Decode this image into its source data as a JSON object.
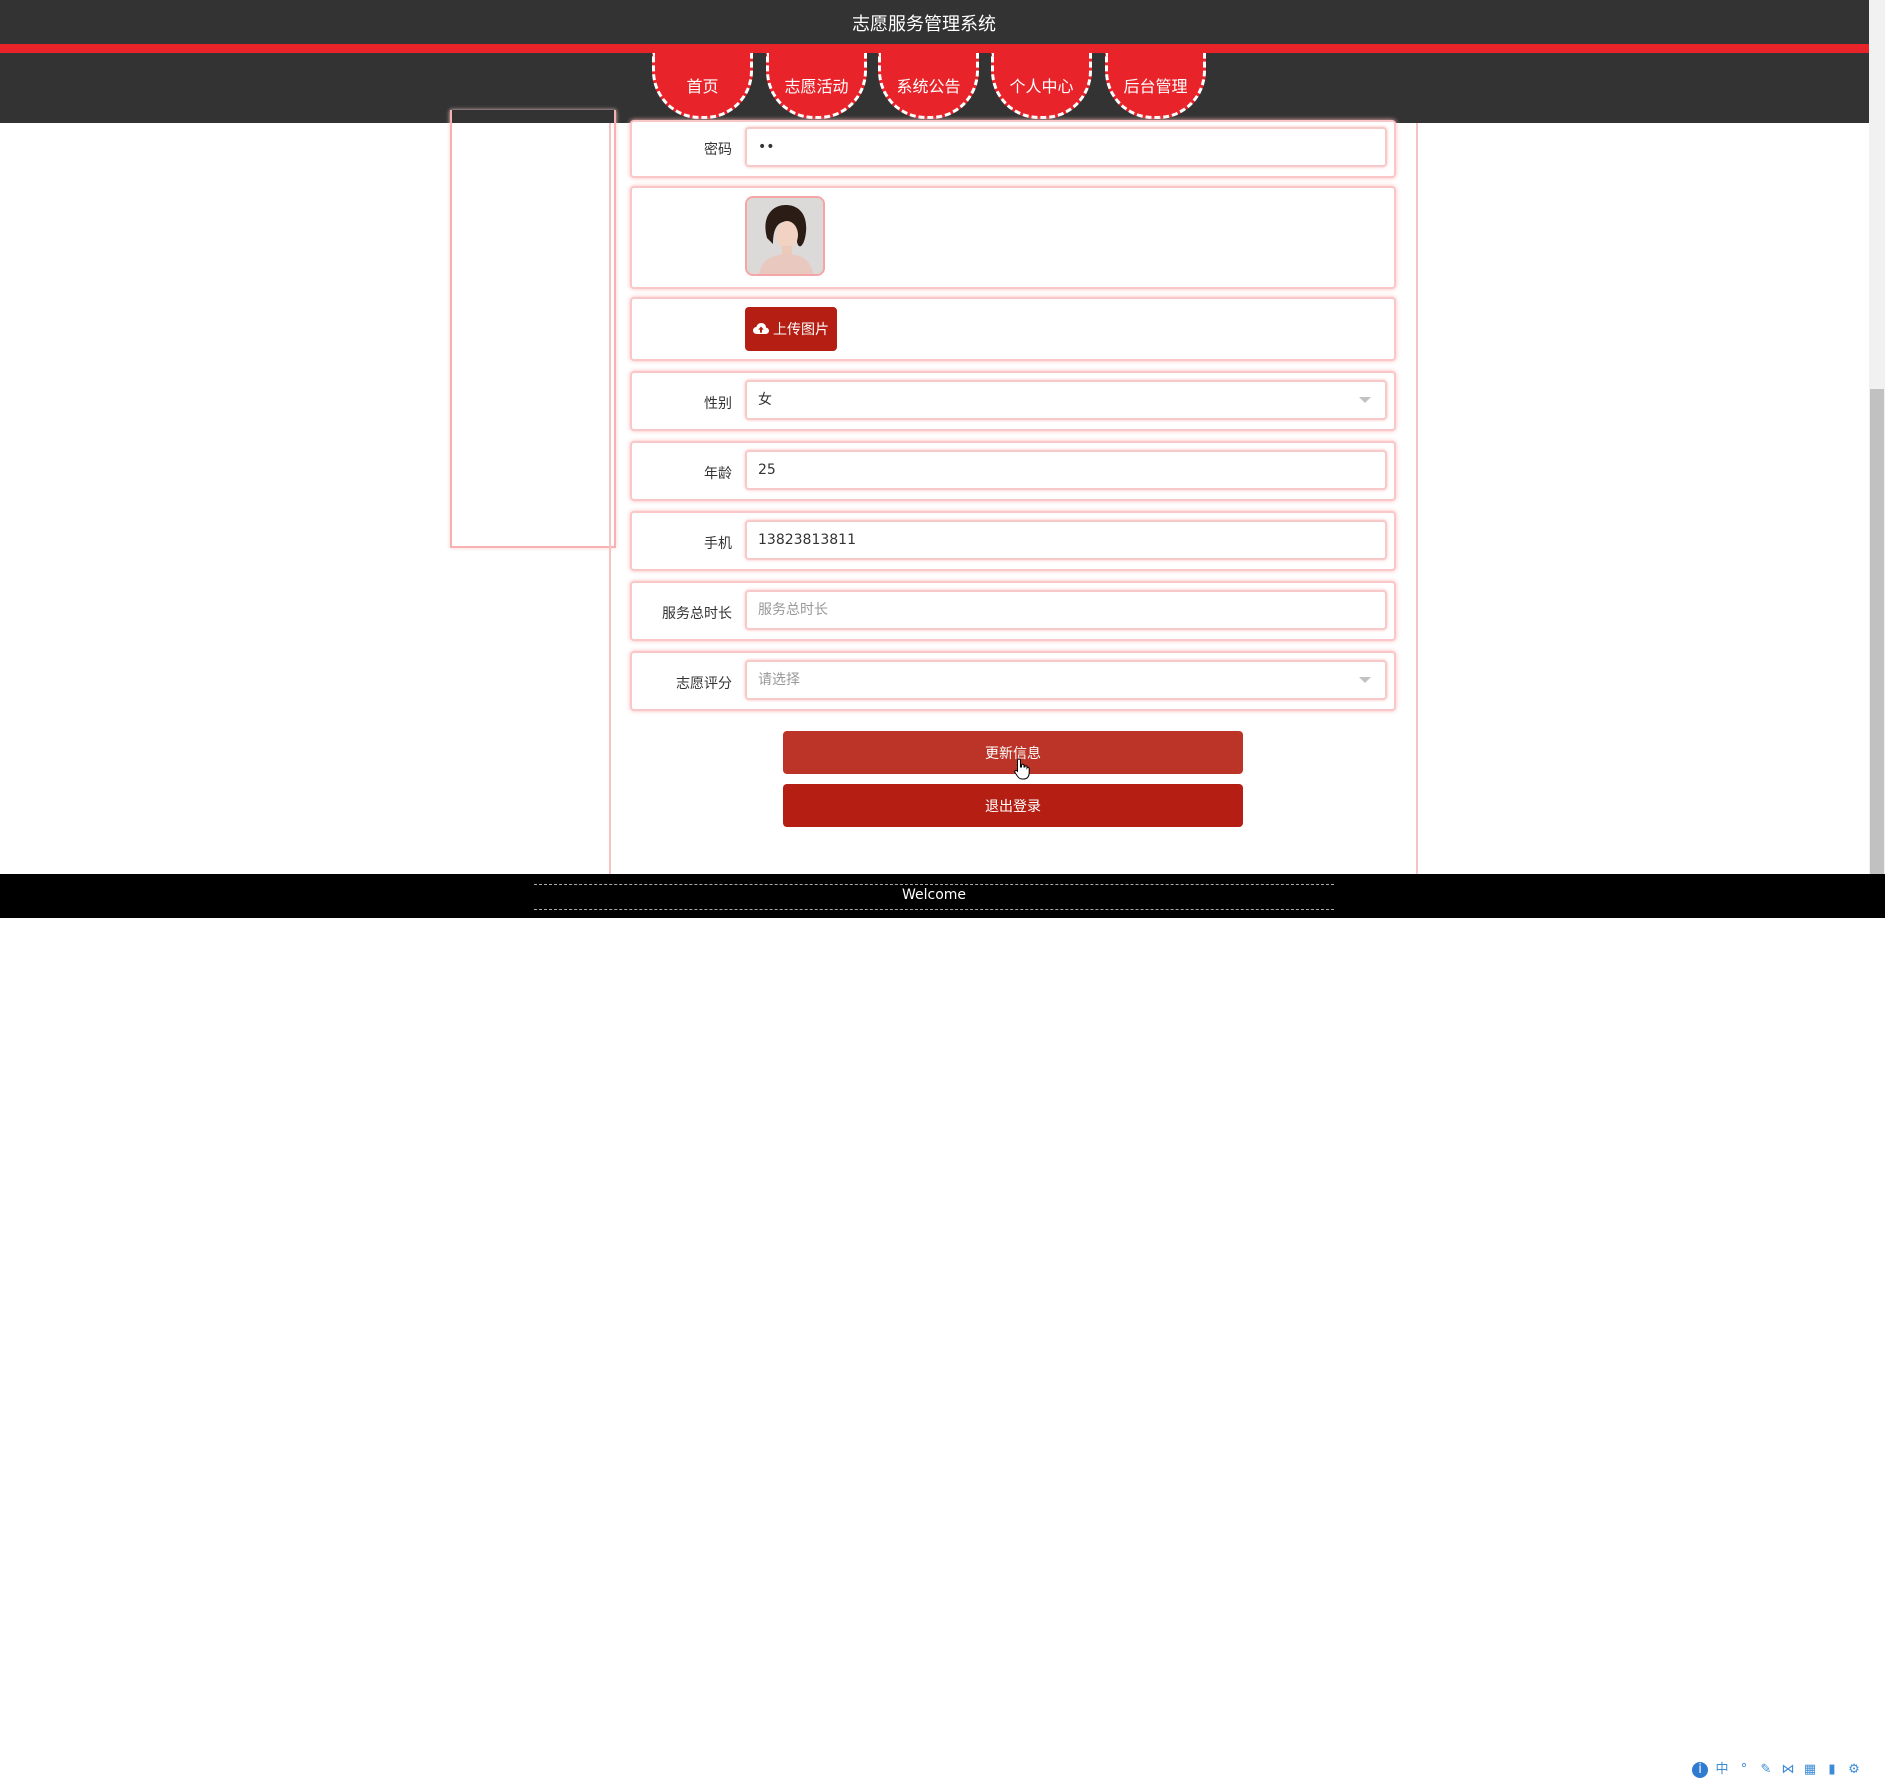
{
  "header": {
    "title": "志愿服务管理系统"
  },
  "nav": {
    "items": [
      "首页",
      "志愿活动",
      "系统公告",
      "个人中心",
      "后台管理"
    ]
  },
  "form": {
    "password": {
      "label": "密码",
      "value": "••"
    },
    "upload_label": "上传图片",
    "gender": {
      "label": "性别",
      "value": "女"
    },
    "age": {
      "label": "年龄",
      "value": "25"
    },
    "phone": {
      "label": "手机",
      "value": "13823813811"
    },
    "service_hours": {
      "label": "服务总时长",
      "placeholder": "服务总时长"
    },
    "rating": {
      "label": "志愿评分",
      "placeholder": "请选择"
    }
  },
  "buttons": {
    "update": "更新信息",
    "logout": "退出登录"
  },
  "footer": {
    "text": "Welcome"
  },
  "colors": {
    "accent": "#e8232a",
    "button_dark": "#b41e13",
    "button_update": "#bb3427"
  }
}
